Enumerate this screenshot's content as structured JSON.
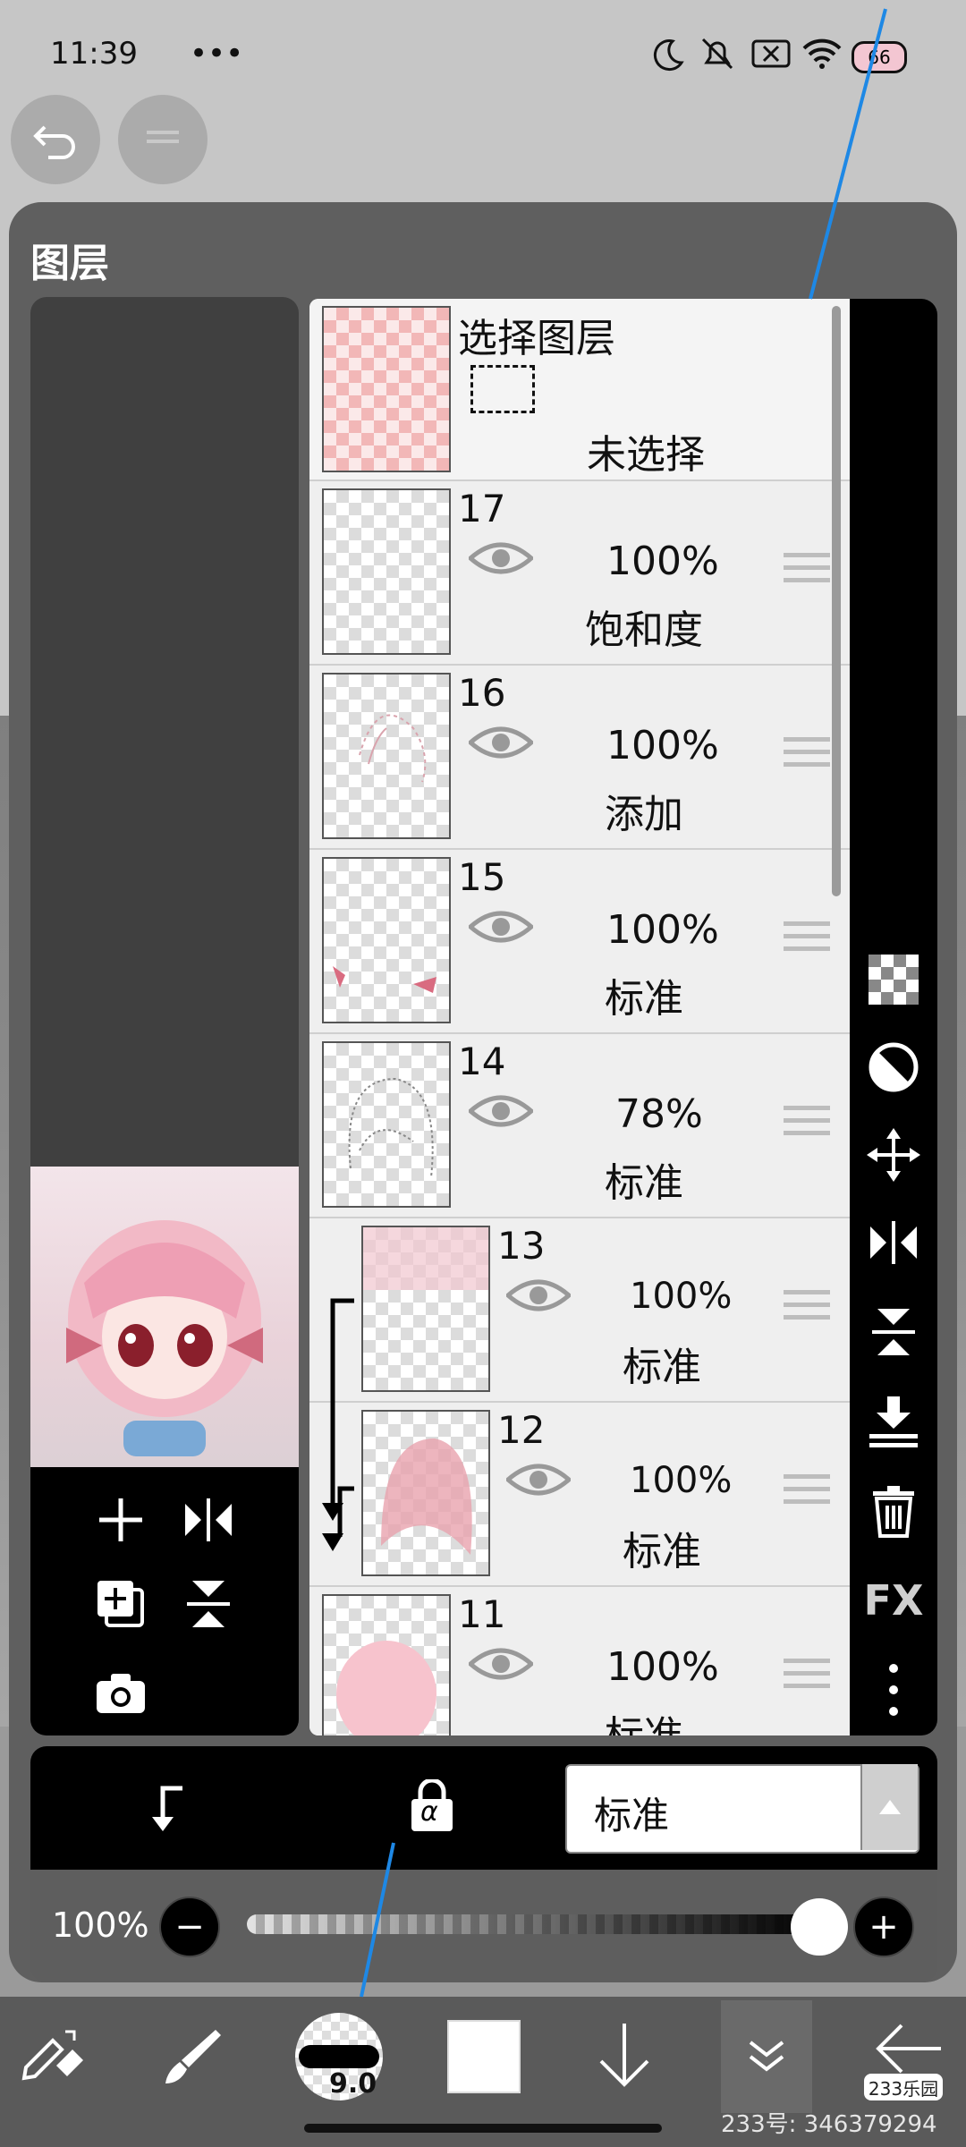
{
  "status_bar": {
    "time": "11:39",
    "dots": "•••",
    "battery": "66"
  },
  "panel": {
    "title": "图层"
  },
  "selection_row": {
    "title": "选择图层",
    "status": "未选择"
  },
  "layers": [
    {
      "number": "17",
      "opacity": "100%",
      "blend": "饱和度"
    },
    {
      "number": "16",
      "opacity": "100%",
      "blend": "添加"
    },
    {
      "number": "15",
      "opacity": "100%",
      "blend": "标准"
    },
    {
      "number": "14",
      "opacity": "78%",
      "blend": "标准"
    },
    {
      "number": "13",
      "opacity": "100%",
      "blend": "标准"
    },
    {
      "number": "12",
      "opacity": "100%",
      "blend": "标准"
    },
    {
      "number": "11",
      "opacity": "100%",
      "blend": "标准"
    }
  ],
  "right_tools": {
    "fx_label": "FX"
  },
  "blend_bar": {
    "mode": "标准",
    "alpha_symbol": "α"
  },
  "opacity_control": {
    "label": "100%",
    "minus": "−",
    "plus": "+",
    "value_percent": 100
  },
  "bottom_toolbar": {
    "brush_size": "9.0"
  },
  "watermark": {
    "logo": "233乐园",
    "text": "233号: 346379294"
  },
  "colors": {
    "panel": "#5f5f5f",
    "toolbar": "#000000",
    "accent_line": "#1e88e5"
  }
}
